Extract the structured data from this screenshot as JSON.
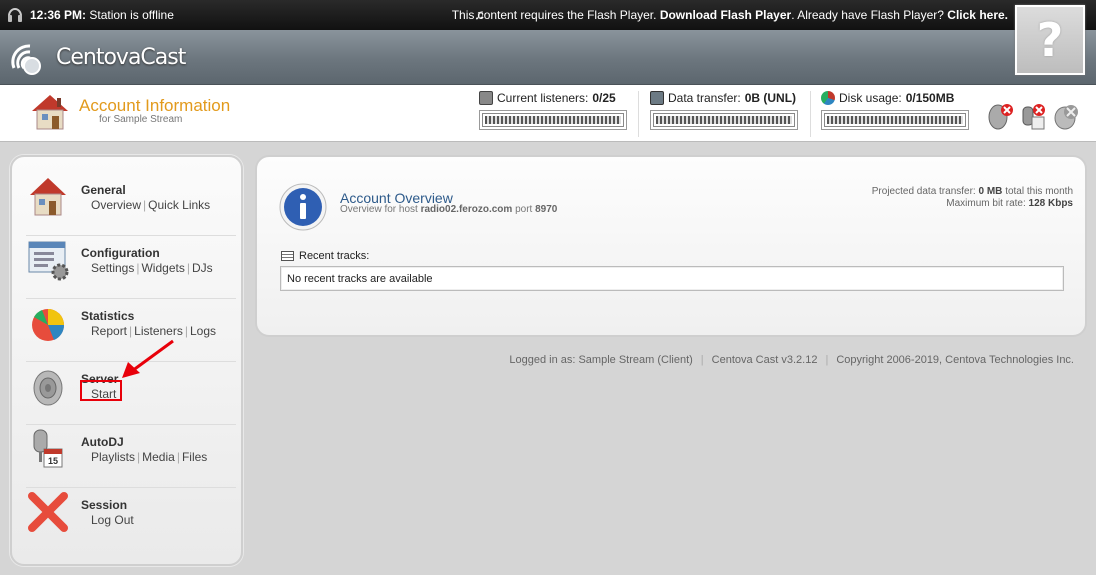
{
  "topbar": {
    "time": "12:36 PM:",
    "status": "Station is offline",
    "flash_pre": "This content requires the Flash Player.",
    "flash_download": "Download Flash Player",
    "flash_mid": "Already have Flash Player?",
    "flash_click": "Click here."
  },
  "brand": {
    "name": "CentovaCast",
    "help_glyph": "?"
  },
  "info": {
    "title": "Account Information",
    "subtitle": "for Sample Stream",
    "listeners_label": "Current listeners:",
    "listeners_value": "0/25",
    "transfer_label": "Data transfer:",
    "transfer_value": "0B (UNL)",
    "disk_label": "Disk usage:",
    "disk_value": "0/150MB"
  },
  "sidebar": {
    "general": {
      "title": "General",
      "links": [
        "Overview",
        "Quick Links"
      ]
    },
    "configuration": {
      "title": "Configuration",
      "links": [
        "Settings",
        "Widgets",
        "DJs"
      ]
    },
    "statistics": {
      "title": "Statistics",
      "links": [
        "Report",
        "Listeners",
        "Logs"
      ]
    },
    "server": {
      "title": "Server",
      "links": [
        "Start"
      ]
    },
    "autodj": {
      "title": "AutoDJ",
      "links": [
        "Playlists",
        "Media",
        "Files"
      ]
    },
    "session": {
      "title": "Session",
      "links": [
        "Log Out"
      ]
    }
  },
  "overview": {
    "title": "Account Overview",
    "sub_pre": "Overview for host",
    "host": "radio02.ferozo.com",
    "sub_port_label": "port",
    "port": "8970",
    "proj_label": "Projected data transfer:",
    "proj_value": "0 MB",
    "proj_suffix": "total this month",
    "bitrate_label": "Maximum bit rate:",
    "bitrate_value": "128 Kbps",
    "recent_label": "Recent tracks:",
    "recent_empty": "No recent tracks are available"
  },
  "footer": {
    "logged": "Logged in as: Sample Stream (Client)",
    "version": "Centova Cast v3.2.12",
    "copyright": "Copyright 2006-2019, Centova Technologies Inc."
  }
}
